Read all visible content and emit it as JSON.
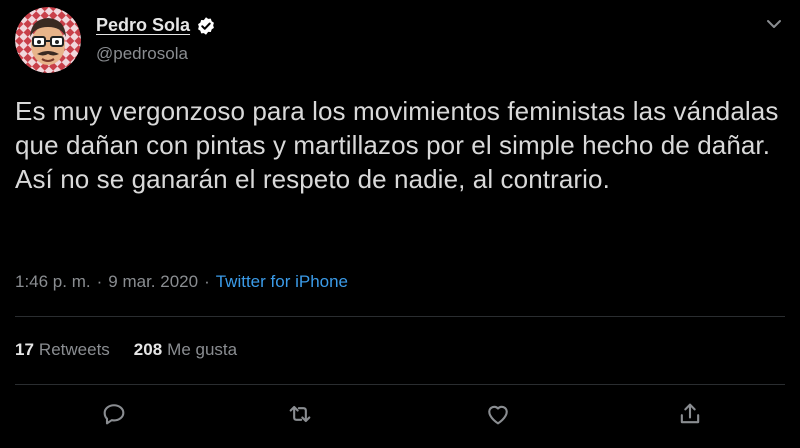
{
  "user": {
    "display_name": "Pedro Sola",
    "handle": "@pedrosola",
    "verified": true,
    "avatar_icon": "avatar-illustration"
  },
  "tweet": {
    "text": "Es muy vergonzoso para los movimientos feministas las vándalas que dañan con pintas y martillazos por el simple hecho de dañar. Así no se ganarán el respeto de nadie, al contrario.",
    "time": "1:46 p. m.",
    "separator": "·",
    "date": "9 mar. 2020",
    "source": "Twitter for iPhone"
  },
  "stats": {
    "retweets_count": "17",
    "retweets_label": "Retweets",
    "likes_count": "208",
    "likes_label": "Me gusta"
  },
  "actions": {
    "reply_icon": "reply-icon",
    "retweet_icon": "retweet-icon",
    "like_icon": "heart-icon",
    "share_icon": "share-icon"
  },
  "colors": {
    "background": "#000000",
    "text": "#d9d9d9",
    "muted": "#8a8d91",
    "link": "#3b9be8",
    "verified": "#ffffff"
  }
}
